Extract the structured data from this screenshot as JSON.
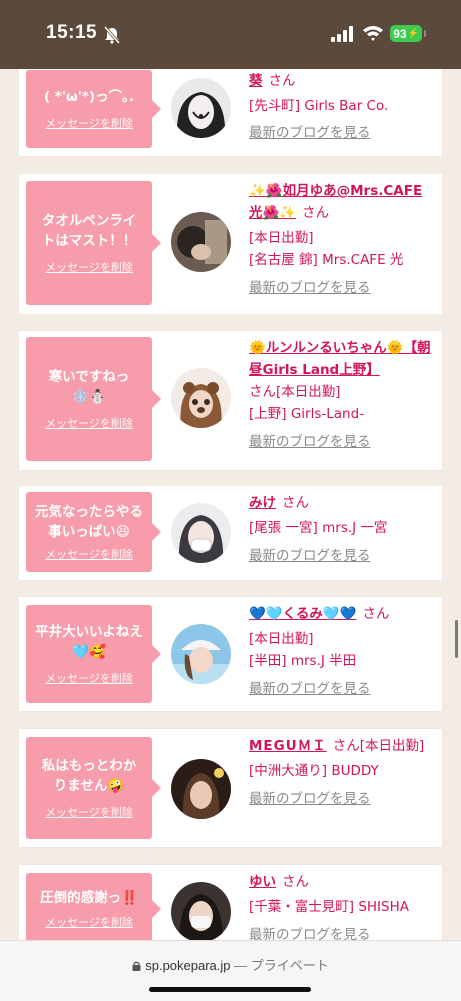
{
  "status": {
    "time": "15:15",
    "battery": "93"
  },
  "delete_label": "メッセージを削除",
  "blog_label": "最新のブログを見る",
  "san": "さん",
  "browser": {
    "domain": "sp.pokepara.jp",
    "separator": " — ",
    "mode": "プライベート"
  },
  "cards": [
    {
      "message": "( *'ω'*)っ⌒｡.",
      "name": "葵",
      "lines": [
        "[先斗町] Girls Bar Co."
      ]
    },
    {
      "message": "タオルペンライトはマスト！！",
      "name": "✨🌺如月ゆあ@Mrs.CAFE光🌺✨",
      "lines": [
        "[本日出勤]",
        "[名古屋 錦] Mrs.CAFE 光"
      ]
    },
    {
      "message": "寒いですねっ❄️⛄",
      "name": "🌞ルンルンるいちゃん🌞【朝昼Girls Land上野】",
      "lines": [
        "[本日出勤]",
        "[上野] Girls-Land-"
      ]
    },
    {
      "message": "元気なったらやる事いっぱい😆",
      "name": "みけ",
      "lines": [
        "[尾張 一宮] mrs.J 一宮"
      ]
    },
    {
      "message": "平井大いいよねえ🩵🥰",
      "name": "💙🩵くるみ🩵💙",
      "lines": [
        "[本日出勤]",
        "[半田] mrs.J 半田"
      ]
    },
    {
      "message": "私はもっとわかりません🤪",
      "name": "MEGUＭＩ",
      "lines": [
        "[本日出勤]",
        "[中洲大通り] BUDDY"
      ]
    },
    {
      "message": "圧倒的感謝っ‼️",
      "name": "ゆい",
      "lines": [
        "[千葉・富士見町] SHISHA"
      ]
    }
  ]
}
